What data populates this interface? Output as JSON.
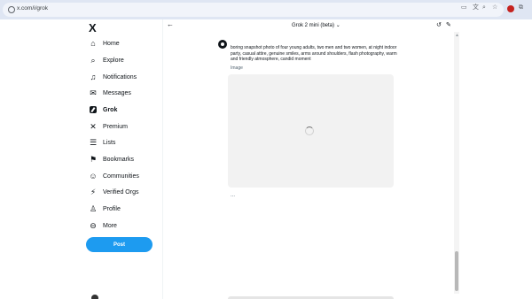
{
  "browser": {
    "url": "x.com/i/grok",
    "icons": [
      "cast-icon",
      "translate-icon",
      "zoom-icon",
      "star-icon",
      "profile-icon",
      "extensions-icon"
    ],
    "profile_color": "#c5221f"
  },
  "sidebar": {
    "logo": "X",
    "items": [
      {
        "label": "Home",
        "icon": "home-icon"
      },
      {
        "label": "Explore",
        "icon": "search-icon"
      },
      {
        "label": "Notifications",
        "icon": "bell-icon"
      },
      {
        "label": "Messages",
        "icon": "mail-icon"
      },
      {
        "label": "Grok",
        "icon": "grok-icon",
        "active": true
      },
      {
        "label": "Premium",
        "icon": "x-icon"
      },
      {
        "label": "Lists",
        "icon": "list-icon"
      },
      {
        "label": "Bookmarks",
        "icon": "bookmark-icon"
      },
      {
        "label": "Communities",
        "icon": "people-icon"
      },
      {
        "label": "Verified Orgs",
        "icon": "lightning-icon"
      },
      {
        "label": "Profile",
        "icon": "person-icon"
      },
      {
        "label": "More",
        "icon": "more-circle-icon"
      }
    ],
    "post_label": "Post",
    "accent": "#1d9bf0"
  },
  "grok": {
    "title": "Grok 2 mini (beta)",
    "message": {
      "text": "boring snapshot photo of four young adults, two men and two women, at night indoor party, casual attire, genuine smiles, arms around shoulders, flash photography, warm and friendly atmosphere, candid moment",
      "image_label": "Image",
      "ellipsis": "..."
    }
  }
}
